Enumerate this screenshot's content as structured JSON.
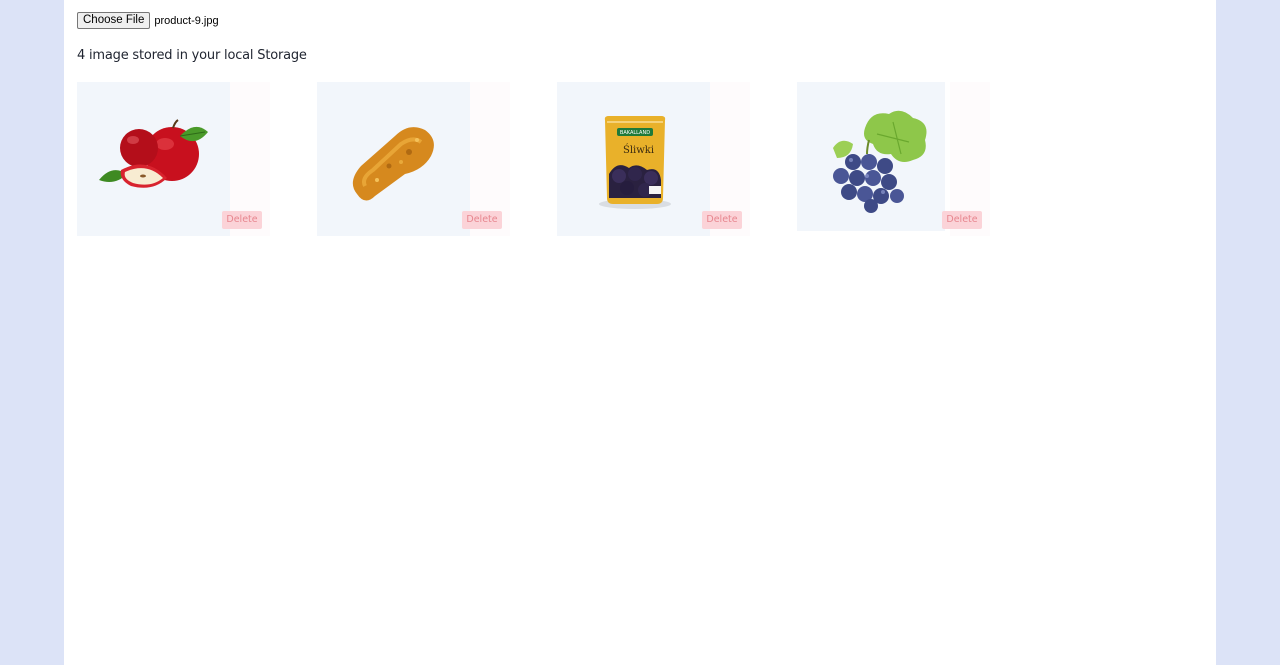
{
  "file_input": {
    "button_label": "Choose File",
    "file_name": "product-9.jpg"
  },
  "status": {
    "stored_text": "4 image stored in your local Storage"
  },
  "images": [
    {
      "alt": "apple",
      "delete_label": "Delete"
    },
    {
      "alt": "chicken-leg",
      "delete_label": "Delete"
    },
    {
      "alt": "plums-package",
      "delete_label": "Delete",
      "package_brand": "BAKALLAND",
      "package_title": "Śliwki"
    },
    {
      "alt": "grapes",
      "delete_label": "Delete"
    }
  ],
  "colors": {
    "background": "#dce3f7",
    "page": "#ffffff",
    "image_box": "#f2f6fb",
    "delete_bg": "#fbd3d8",
    "delete_text": "#e7868f"
  }
}
